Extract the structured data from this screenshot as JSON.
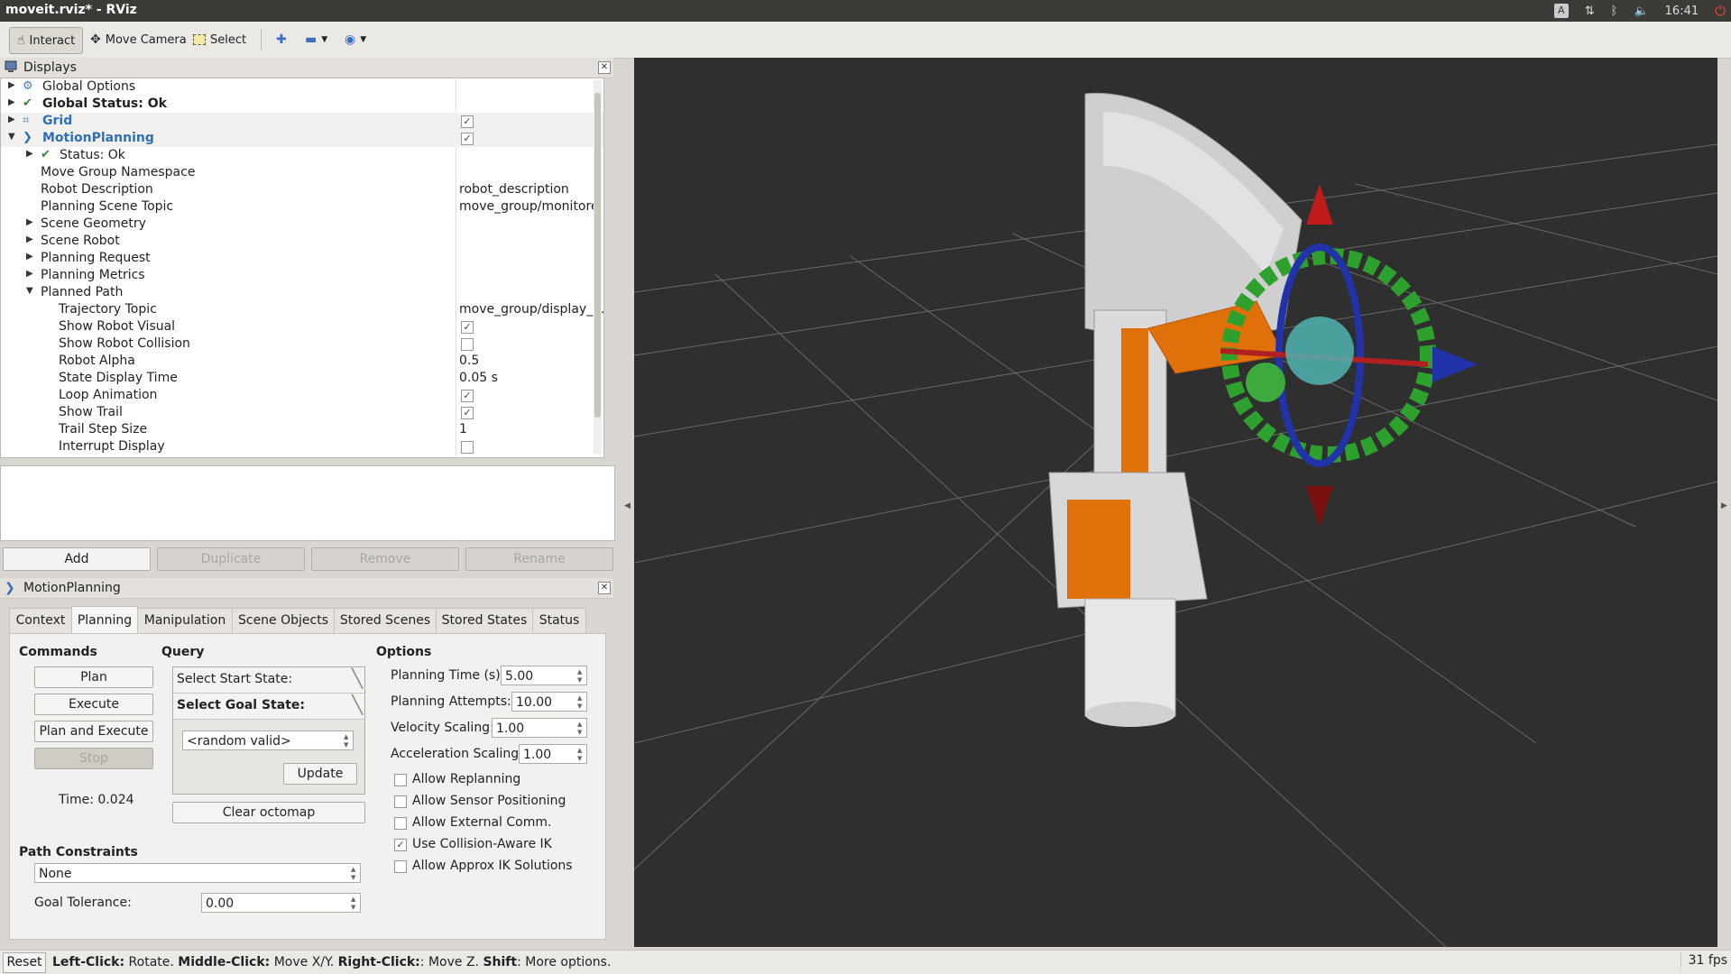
{
  "window": {
    "title": "moveit.rviz* - RViz"
  },
  "tray": {
    "keyboard": "A",
    "clock": "16:41"
  },
  "toolbar": {
    "interact_label": "Interact",
    "move_camera_label": "Move Camera",
    "select_label": "Select"
  },
  "displays": {
    "title": "Displays",
    "rows": [
      {
        "label": "Global Options"
      },
      {
        "label": "Global Status: Ok"
      },
      {
        "label": "Grid"
      },
      {
        "label": "MotionPlanning"
      },
      {
        "label": "Status: Ok"
      },
      {
        "label": "Move Group Namespace",
        "value": ""
      },
      {
        "label": "Robot Description",
        "value": "robot_description"
      },
      {
        "label": "Planning Scene Topic",
        "value": "move_group/monitore."
      },
      {
        "label": "Scene Geometry"
      },
      {
        "label": "Scene Robot"
      },
      {
        "label": "Planning Request"
      },
      {
        "label": "Planning Metrics"
      },
      {
        "label": "Planned Path"
      },
      {
        "label": "Trajectory Topic",
        "value": "move_group/display_..."
      },
      {
        "label": "Show Robot Visual"
      },
      {
        "label": "Show Robot Collision"
      },
      {
        "label": "Robot Alpha",
        "value": "0.5"
      },
      {
        "label": "State Display Time",
        "value": "0.05 s"
      },
      {
        "label": "Loop Animation"
      },
      {
        "label": "Show Trail"
      },
      {
        "label": "Trail Step Size",
        "value": "1"
      },
      {
        "label": "Interrupt Display"
      }
    ],
    "buttons": {
      "add": "Add",
      "duplicate": "Duplicate",
      "remove": "Remove",
      "rename": "Rename"
    }
  },
  "motion": {
    "title": "MotionPlanning",
    "tabs": [
      "Context",
      "Planning",
      "Manipulation",
      "Scene Objects",
      "Stored Scenes",
      "Stored States",
      "Status"
    ],
    "commands": {
      "title": "Commands",
      "plan": "Plan",
      "execute": "Execute",
      "plan_execute": "Plan and Execute",
      "stop": "Stop",
      "time": "Time: 0.024"
    },
    "query": {
      "title": "Query",
      "start": "Select Start State:",
      "goal": "Select Goal State:",
      "goal_value": "<random valid>",
      "update": "Update",
      "clear_octomap": "Clear octomap"
    },
    "options": {
      "title": "Options",
      "planning_time_label": "Planning Time (s):",
      "planning_time": "5.00",
      "planning_attempts_label": "Planning Attempts:",
      "planning_attempts": "10.00",
      "velocity_label": "Velocity Scaling:",
      "velocity": "1.00",
      "accel_label": "Acceleration Scaling:",
      "accel": "1.00",
      "checks": [
        {
          "label": "Allow Replanning"
        },
        {
          "label": "Allow Sensor Positioning"
        },
        {
          "label": "Allow External Comm."
        },
        {
          "label": "Use Collision-Aware IK"
        },
        {
          "label": "Allow Approx IK Solutions"
        }
      ]
    },
    "constraints": {
      "title": "Path Constraints",
      "value": "None",
      "tolerance_label": "Goal Tolerance:",
      "tolerance": "0.00"
    }
  },
  "status": {
    "reset": "Reset",
    "hint_parts": [
      {
        "b": "Left-Click:",
        "t": " Rotate. "
      },
      {
        "b": "Middle-Click:",
        "t": " Move X/Y. "
      },
      {
        "b": "Right-Click:",
        "t": ": Move Z. "
      },
      {
        "b": "Shift",
        "t": ": More options."
      }
    ],
    "fps": "31 fps"
  },
  "colors": {
    "accent_blue": "#2f6fb7",
    "robot_orange": "#e0700a",
    "viewport_bg": "#2f2f2f"
  }
}
